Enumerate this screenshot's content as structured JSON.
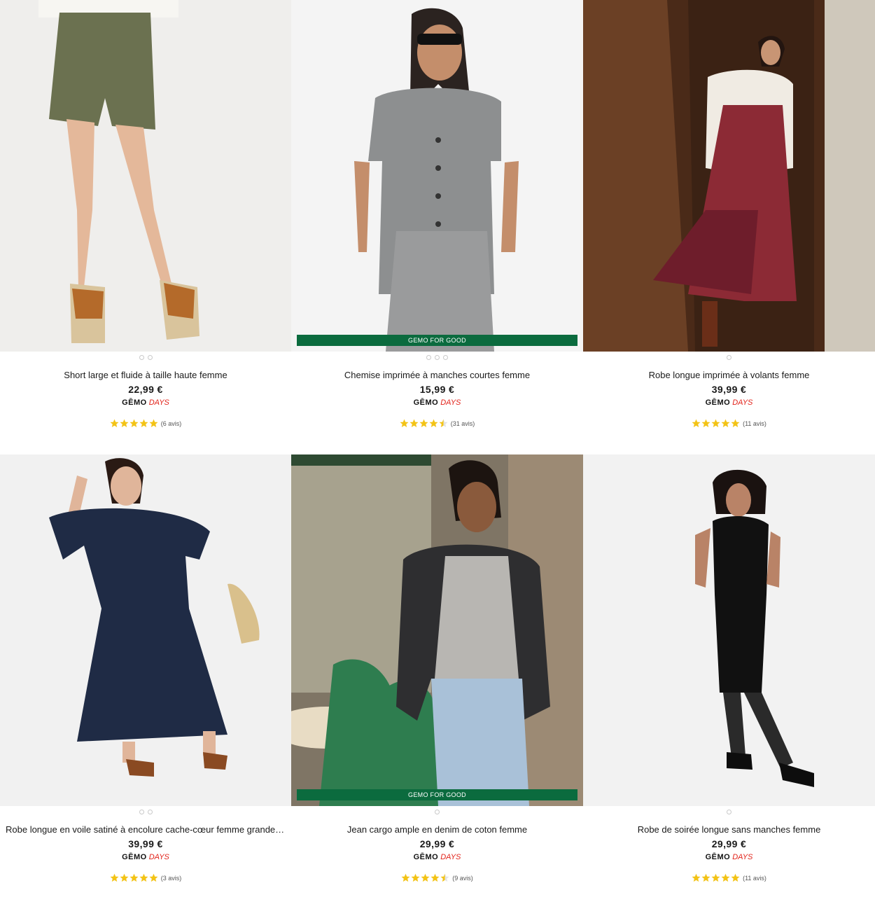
{
  "colors": {
    "accent_green": "#0b6b3e",
    "days_red": "#e2231a",
    "star_yellow": "#f3c316"
  },
  "products": [
    {
      "name": "Short large et fluide à taille haute femme",
      "price": "22,99 €",
      "badge_brand": "GĒMO",
      "badge_days": "DAYS",
      "rating": 5,
      "reviews": "(6 avis)",
      "promo": "",
      "dots": 2,
      "image": "woman-in-olive-shorts-and-sandals"
    },
    {
      "name": "Chemise imprimée à manches courtes femme",
      "price": "15,99 €",
      "badge_brand": "GĒMO",
      "badge_days": "DAYS",
      "rating": 4.5,
      "reviews": "(31 avis)",
      "promo": "GEMO FOR GOOD",
      "dots": 3,
      "image": "woman-in-printed-shirt-and-pants"
    },
    {
      "name": "Robe longue imprimée à volants femme",
      "price": "39,99 €",
      "badge_brand": "GĒMO",
      "badge_days": "DAYS",
      "rating": 5,
      "reviews": "(11 avis)",
      "promo": "",
      "dots": 1,
      "image": "woman-in-printed-maxi-dress-by-wooden-door"
    },
    {
      "name": "Robe longue en voile satiné à encolure cache-cœur femme grande …",
      "price": "39,99 €",
      "badge_brand": "GĒMO",
      "badge_days": "DAYS",
      "rating": 5,
      "reviews": "(3 avis)",
      "promo": "",
      "dots": 2,
      "image": "woman-in-navy-wrap-dress"
    },
    {
      "name": "Jean cargo ample en denim de coton femme",
      "price": "29,99 €",
      "badge_brand": "GĒMO",
      "badge_days": "DAYS",
      "rating": 4.5,
      "reviews": "(9 avis)",
      "promo": "GEMO FOR GOOD",
      "dots": 1,
      "image": "woman-in-cargo-jeans-at-cafe"
    },
    {
      "name": "Robe de soirée longue sans manches femme",
      "price": "29,99 €",
      "badge_brand": "GĒMO",
      "badge_days": "DAYS",
      "rating": 5,
      "reviews": "(11 avis)",
      "promo": "",
      "dots": 1,
      "image": "woman-in-black-sleeveless-dress"
    }
  ]
}
